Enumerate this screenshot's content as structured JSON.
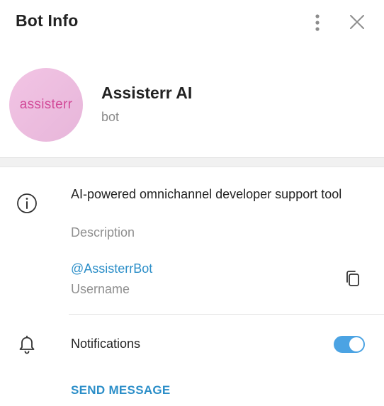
{
  "header": {
    "title": "Bot Info",
    "more_icon": "more-vertical-icon",
    "close_icon": "close-icon"
  },
  "profile": {
    "avatar_text": "assisterr",
    "name": "Assisterr AI",
    "type": "bot"
  },
  "info": {
    "icon": "info-icon",
    "description": "AI-powered omnichannel developer support tool",
    "description_label": "Description",
    "username": "@AssisterrBot",
    "username_label": "Username",
    "copy_icon": "copy-icon"
  },
  "notifications": {
    "icon": "bell-icon",
    "label": "Notifications",
    "enabled": true
  },
  "actions": {
    "send_message": "SEND MESSAGE"
  },
  "colors": {
    "accent": "#2b8ec8",
    "toggle_on": "#4ba3e3",
    "avatar_bg": "#ecbde0",
    "avatar_text": "#d24a98"
  }
}
